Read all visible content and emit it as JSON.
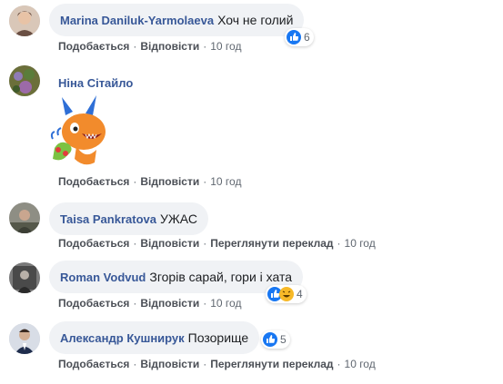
{
  "actions": {
    "like": "Подобається",
    "reply": "Відповісти",
    "translate": "Переглянути переклад",
    "sep": "·"
  },
  "comments": [
    {
      "author": "Marina Daniluk-Yarmolaeva",
      "text": "Хоч не голий",
      "time": "10 год",
      "reactions": {
        "count": "6",
        "icons": [
          "like-reaction-icon"
        ]
      }
    },
    {
      "author": "Ніна Сітайло",
      "sticker": "dragon-sticker",
      "time": "10 год"
    },
    {
      "author": "Taisa Pankratova",
      "text": "УЖАС",
      "time": "10 год"
    },
    {
      "author": "Roman Vodvud",
      "text": "Згорів сарай, гори і хата",
      "time": "10 год",
      "reactions": {
        "count": "4",
        "icons": [
          "like-reaction-icon",
          "haha-reaction-icon"
        ]
      }
    },
    {
      "author": "Александр Кушнирук",
      "text": "Позорище",
      "time": "10 год",
      "reactions": {
        "count": "5",
        "icons": [
          "like-reaction-icon"
        ]
      }
    }
  ],
  "colors": {
    "link": "#385898",
    "bubble": "#f0f2f5",
    "like": "#1877f2",
    "haha": "#f7b928"
  }
}
